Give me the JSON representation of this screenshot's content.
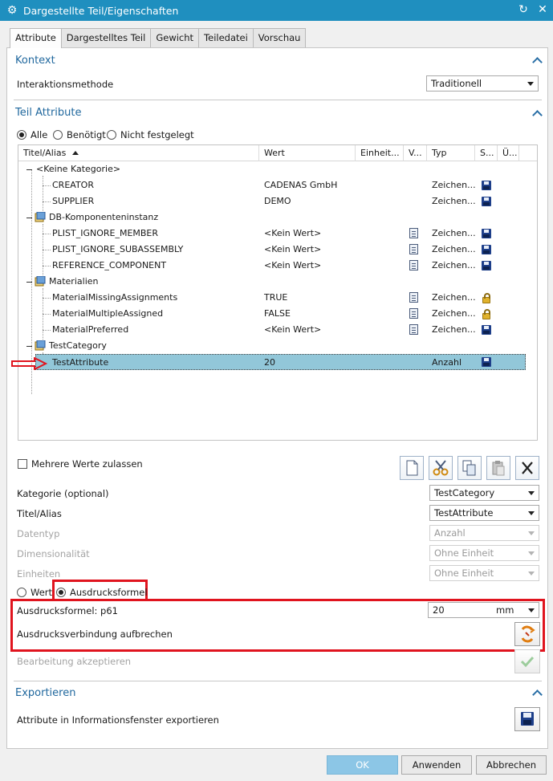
{
  "window": {
    "title": "Dargestellte Teil/Eigenschaften"
  },
  "tabs": [
    "Attribute",
    "Dargestelltes Teil",
    "Gewicht",
    "Teiledatei",
    "Vorschau"
  ],
  "kontext": {
    "header": "Kontext",
    "method_label": "Interaktionsmethode",
    "method_value": "Traditionell"
  },
  "teil_attribute": {
    "header": "Teil Attribute",
    "filter": {
      "alle": "Alle",
      "benoetigt": "Benötigt",
      "nicht": "Nicht festgelegt"
    },
    "columns": [
      "Titel/Alias",
      "Wert",
      "Einheit...",
      "V...",
      "Typ",
      "S...",
      "Ü..."
    ],
    "categories": [
      {
        "name": "<Keine Kategorie>"
      },
      {
        "name": "DB-Komponenteninstanz"
      },
      {
        "name": "Materialien"
      },
      {
        "name": "TestCategory"
      }
    ],
    "rows": [
      {
        "title": "CREATOR",
        "value": "CADENAS GmbH",
        "type": "Zeichen..."
      },
      {
        "title": "SUPPLIER",
        "value": "DEMO",
        "type": "Zeichen..."
      },
      {
        "title": "PLIST_IGNORE_MEMBER",
        "value": "<Kein Wert>",
        "type": "Zeichen..."
      },
      {
        "title": "PLIST_IGNORE_SUBASSEMBLY",
        "value": "<Kein Wert>",
        "type": "Zeichen..."
      },
      {
        "title": "REFERENCE_COMPONENT",
        "value": "<Kein Wert>",
        "type": "Zeichen..."
      },
      {
        "title": "MaterialMissingAssignments",
        "value": "TRUE",
        "type": "Zeichen..."
      },
      {
        "title": "MaterialMultipleAssigned",
        "value": "FALSE",
        "type": "Zeichen..."
      },
      {
        "title": "MaterialPreferred",
        "value": "<Kein Wert>",
        "type": "Zeichen..."
      },
      {
        "title": "TestAttribute",
        "value": "20",
        "type": "Anzahl"
      }
    ]
  },
  "editor": {
    "multi_values": "Mehrere Werte zulassen",
    "kategorie_label": "Kategorie (optional)",
    "kategorie_value": "TestCategory",
    "titel_label": "Titel/Alias",
    "titel_value": "TestAttribute",
    "datentyp_label": "Datentyp",
    "datentyp_value": "Anzahl",
    "dim_label": "Dimensionalität",
    "dim_value": "Ohne Einheit",
    "einheiten_label": "Einheiten",
    "einheiten_value": "Ohne Einheit",
    "wert_radio": "Wert",
    "ausdruck_radio": "Ausdrucksformel",
    "ausdruck_label": "Ausdrucksformel: p61",
    "ausdruck_value": "20",
    "ausdruck_unit": "mm",
    "break_label": "Ausdrucksverbindung aufbrechen",
    "accept_label": "Bearbeitung akzeptieren"
  },
  "exportieren": {
    "header": "Exportieren",
    "export_label": "Attribute in Informationsfenster exportieren"
  },
  "footer": {
    "ok": "OK",
    "apply": "Anwenden",
    "cancel": "Abbrechen"
  },
  "colors": {
    "accent": "#1f8fbf",
    "highlight": "#e0141e",
    "selection": "#92c7d9"
  }
}
